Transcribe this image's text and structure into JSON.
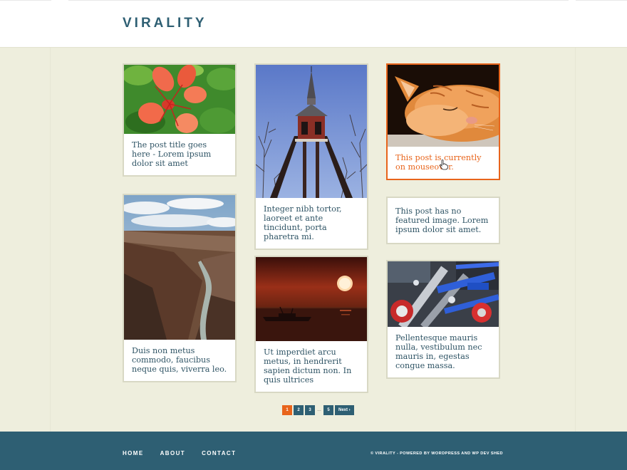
{
  "site": {
    "title": "VIRALITY"
  },
  "posts": [
    {
      "excerpt": "The post title goes here - Lorem ipsum dolor sit amet",
      "image": "red-flower"
    },
    {
      "excerpt": "Integer nibh tortor, laoreet et ante tincidunt, porta pharetra mi.",
      "image": "bell-tower"
    },
    {
      "excerpt": "This post is currently on mouseover.",
      "image": "sleeping-cat",
      "state": "hover"
    },
    {
      "excerpt": "Duis non metus commodo, faucibus neque quis, viverra leo.",
      "image": "canyon"
    },
    {
      "excerpt": "Ut imperdiet arcu metus, in hendrerit sapien dictum non. In quis ultrices",
      "image": "sunset-boat"
    },
    {
      "excerpt": "This post has no featured image. Lorem ipsum dolor sit amet.",
      "image": null
    },
    {
      "excerpt": "Pellentesque mauris nulla, vestibulum nec mauris in, egestas congue massa.",
      "image": "engine"
    }
  ],
  "pagination": {
    "pages": [
      "1",
      "2",
      "3",
      "5"
    ],
    "current": "1",
    "ellipsis": "…",
    "next": "Next ›"
  },
  "footer": {
    "nav": [
      "HOME",
      "ABOUT",
      "CONTACT"
    ],
    "copyright": "© VIRALITY - POWERED BY WORDPRESS AND WP DEV SHED"
  },
  "colors": {
    "brand": "#2e5f73",
    "accent": "#e8641b",
    "background": "#eeeedd"
  }
}
